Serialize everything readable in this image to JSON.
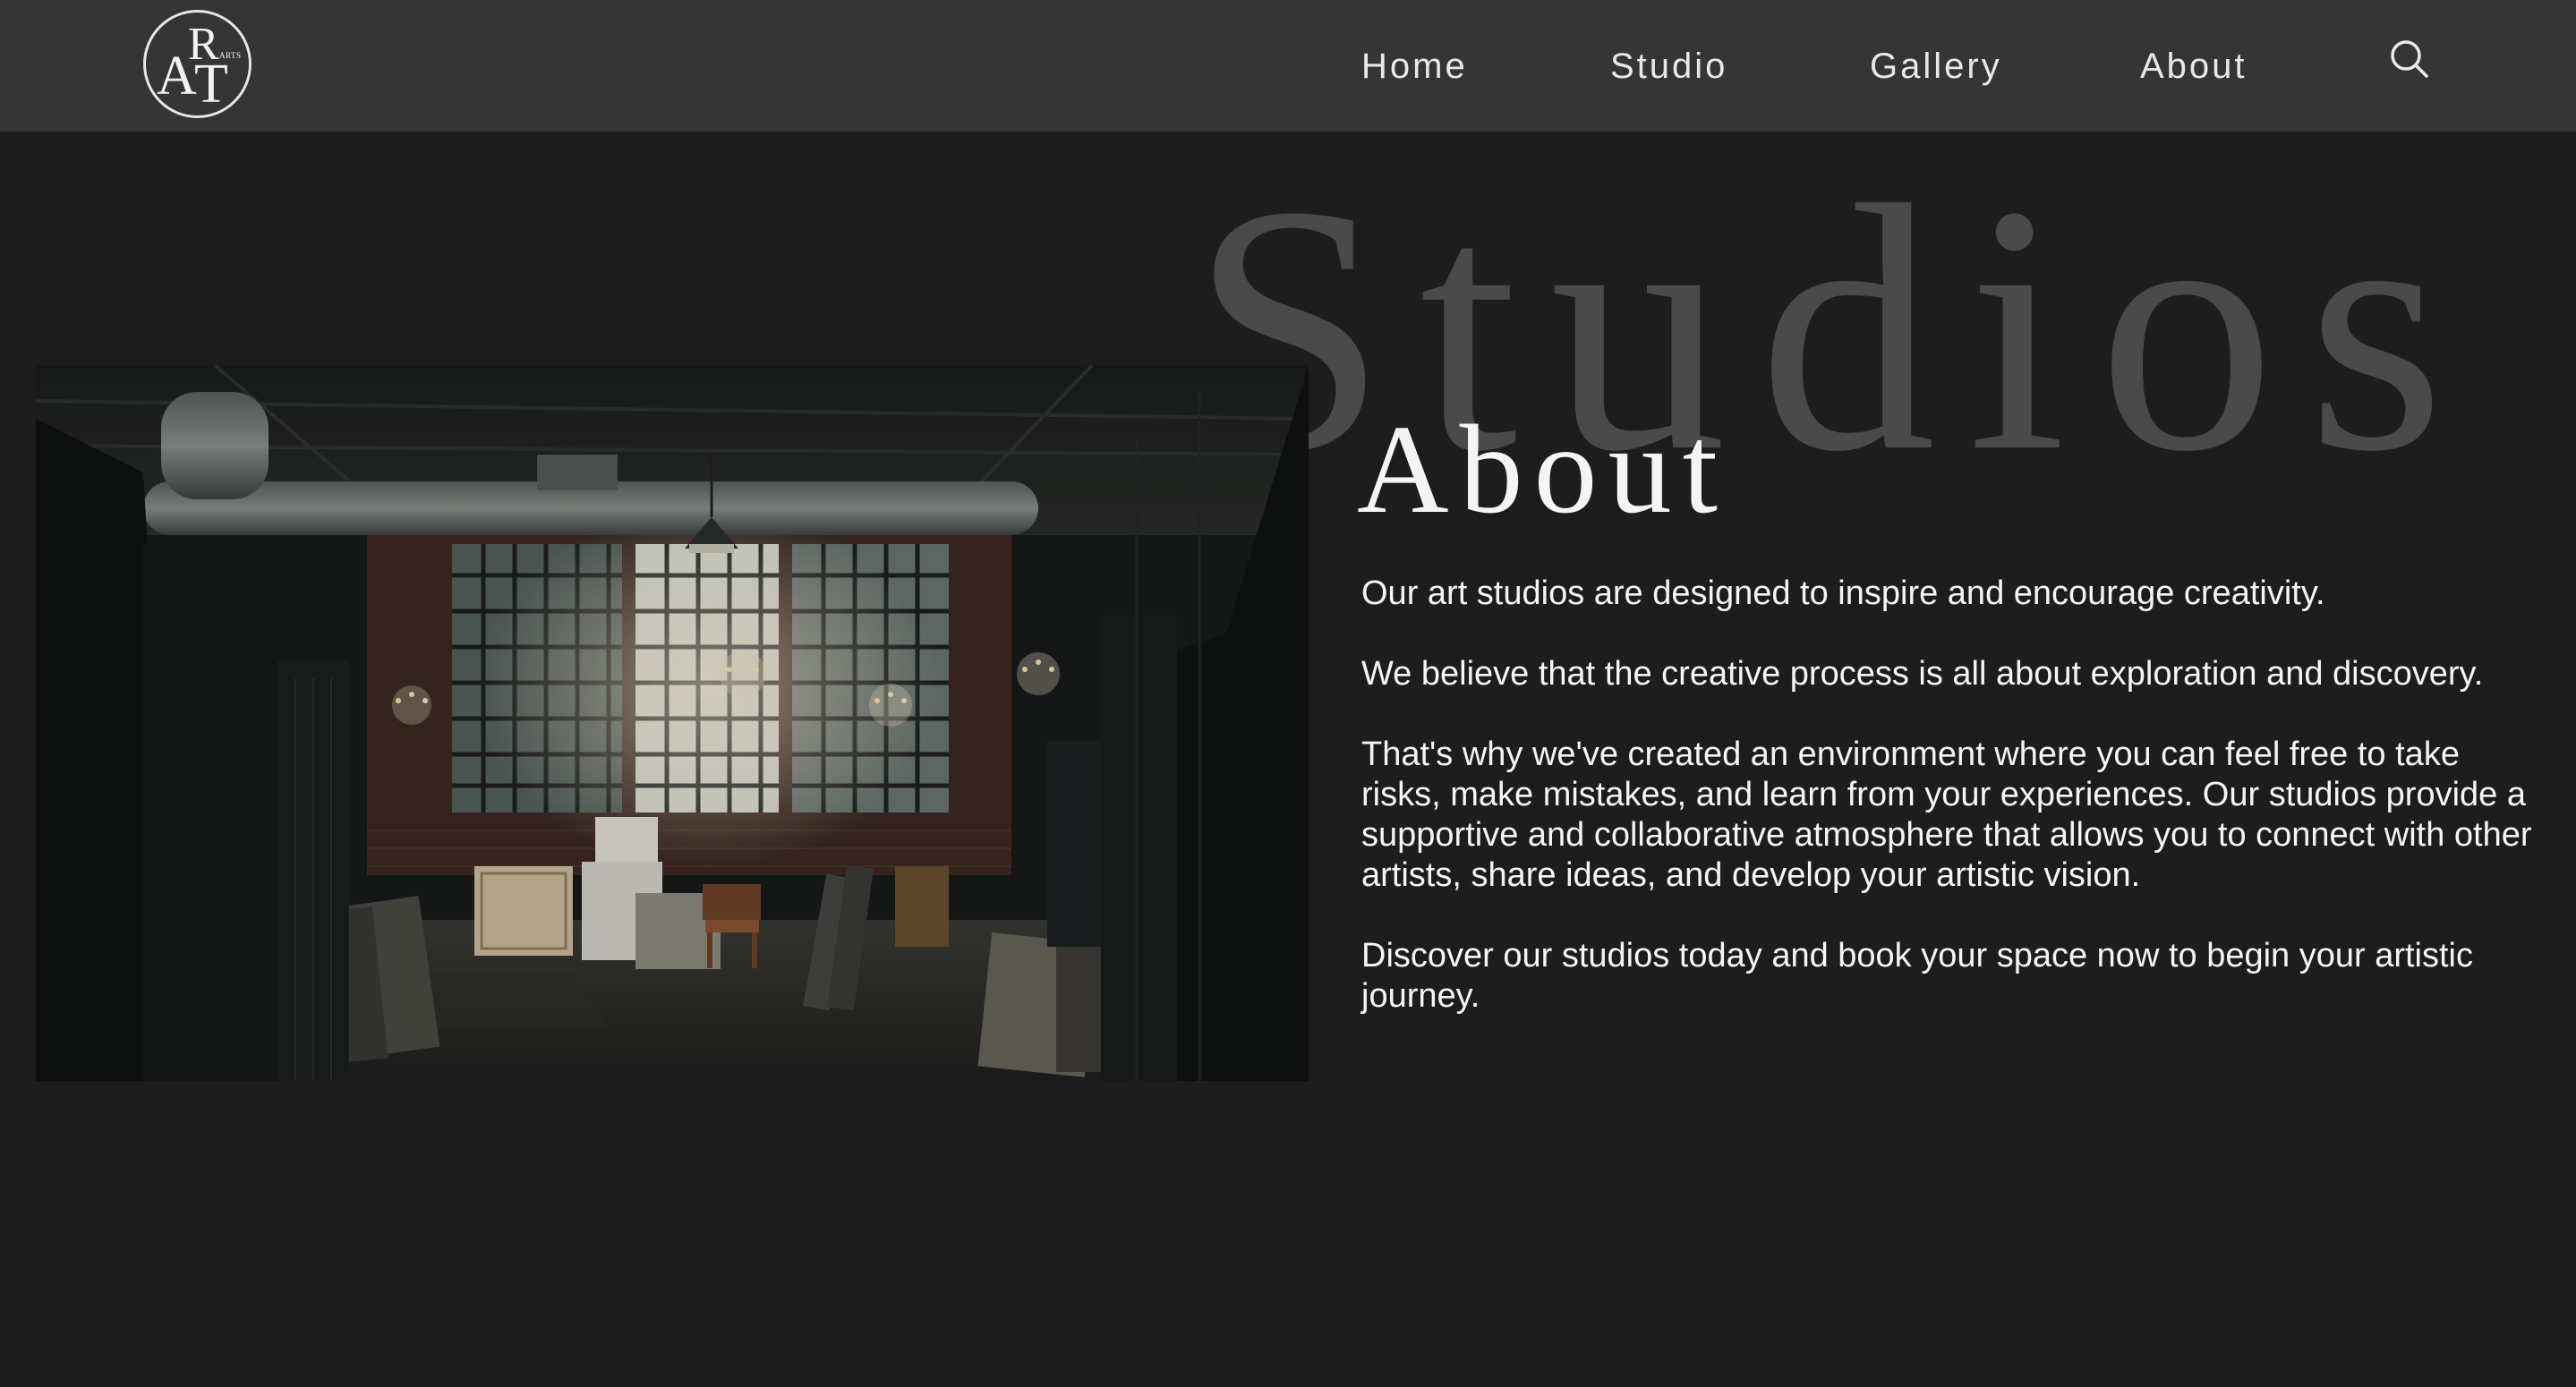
{
  "logo": {
    "letter_a": "A",
    "letter_r": "R",
    "letter_t": "T",
    "small_text": "ARTS"
  },
  "nav": {
    "items": [
      {
        "label": "Home"
      },
      {
        "label": "Studio"
      },
      {
        "label": "Gallery"
      },
      {
        "label": "About"
      }
    ],
    "search_icon": "search-icon"
  },
  "hero": {
    "background_word": "Studios",
    "title": "About",
    "image_alt": "art studio interior",
    "paragraphs": [
      "Our art studios are designed to inspire and encourage creativity.",
      "We believe that the creative process is all about exploration and discovery.",
      "That's why we've created an environment where you can feel free to take risks, make mistakes, and learn from your experiences. Our studios provide a supportive and collaborative atmosphere that allows you to connect with other artists, share ideas, and develop your artistic vision.",
      "Discover our studios today and book your space now to begin your artistic journey."
    ]
  },
  "colors": {
    "header_bg": "#353535",
    "page_bg": "#1d1d1d",
    "watermark": "#4a4a4a",
    "text": "#f5f5f5"
  }
}
